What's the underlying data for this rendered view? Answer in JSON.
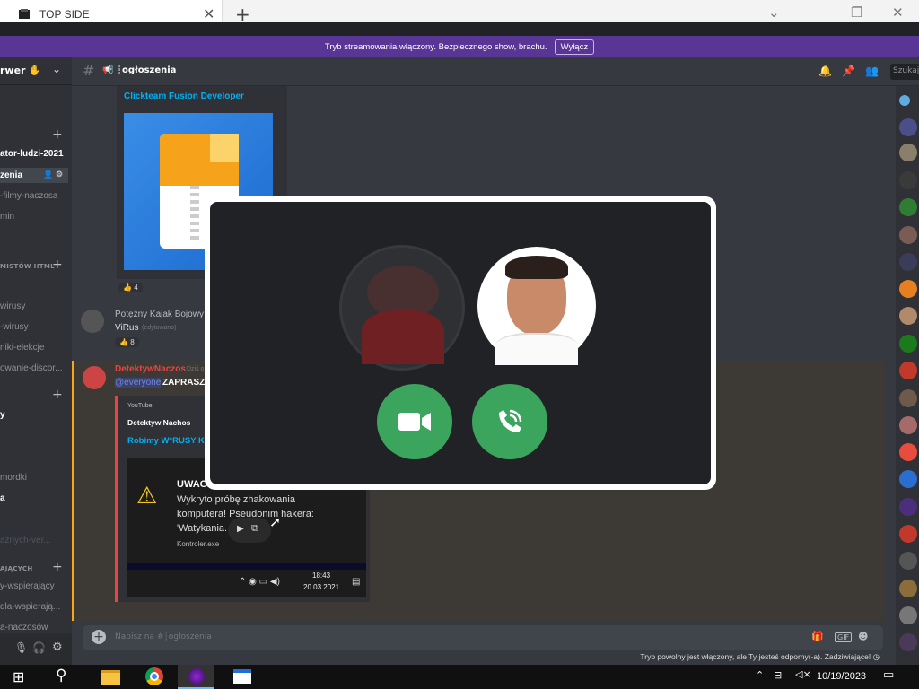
{
  "browser": {
    "tab_title": "TOP SIDE",
    "tab_close": "✕",
    "new_tab": "+"
  },
  "stream_banner": {
    "text": "Tryb streamowania włączony. Bezpiecznego show, brachu.",
    "button": "Wyłącz"
  },
  "sidebar": {
    "server_name": "rwer",
    "channels": [
      {
        "label": "ator-ludzi-2021",
        "bold": true
      },
      {
        "label": "zenia",
        "selected": true
      },
      {
        "label": "-filmy-naczosa"
      },
      {
        "label": "min"
      },
      {
        "label": "MISTÓW HTML",
        "category": true
      },
      {
        "label": "wirusy"
      },
      {
        "label": "-wirusy"
      },
      {
        "label": "niki-elekcje"
      },
      {
        "label": "owanie-discor..."
      },
      {
        "label": "y",
        "bold": true
      },
      {
        "label": "mordki"
      },
      {
        "label": "a",
        "bold": true
      },
      {
        "label": "ażnych-ver..."
      },
      {
        "label": "AJĄCYCH",
        "category": true
      },
      {
        "label": "y-wspierający"
      },
      {
        "label": "dla-wspierają..."
      },
      {
        "label": "a-naczosów"
      }
    ]
  },
  "header": {
    "channel_name": "┆ogłoszenia",
    "search_placeholder": "Szukaj"
  },
  "messages": {
    "embed1_title": "Clickteam Fusion Developer",
    "reaction1": "4",
    "msg2_author": "Potężny Kajak Bojowy",
    "msg2_text": "ViRus",
    "msg2_extra": "(edytowano)",
    "reaction2": "8",
    "msg3_author": "DetektywNaczos",
    "msg3_time": "Dziś o",
    "msg3_mention": "@everyone",
    "msg3_text": "ZAPRASZA",
    "embed2_provider": "YouTube",
    "embed2_author": "Detektyw Nachos",
    "embed2_title": "Robimy W*RUSY KO",
    "video_warning_title": "UWAGA!",
    "video_warning_line1": "Wykryto próbę zhakowania",
    "video_warning_line2": "komputera! Pseudonim hakera:",
    "video_warning_line3": "'Watykania...",
    "video_file": "Kontroler.exe",
    "video_time": "18:43",
    "video_date": "20.03.2021"
  },
  "composer": {
    "placeholder": "Napisz na #┆ogłoszenia"
  },
  "slowmode_text": "Tryb powolny jest włączony, ale Ty jesteś odporny(-a). Zadziwiające!",
  "taskbar": {
    "date": "10/19/2023"
  },
  "colors": {
    "accent_banner": "#593695",
    "call_button": "#3ba55d",
    "mention": "#7289da",
    "link": "#00b0f4",
    "red_name": "#ed4245"
  },
  "icons": [
    "hash-icon",
    "bell-icon",
    "pin-icon",
    "members-icon",
    "camera-icon",
    "phone-icon",
    "gift-icon",
    "gif-icon",
    "emoji-icon",
    "windows-icon",
    "search-icon"
  ]
}
